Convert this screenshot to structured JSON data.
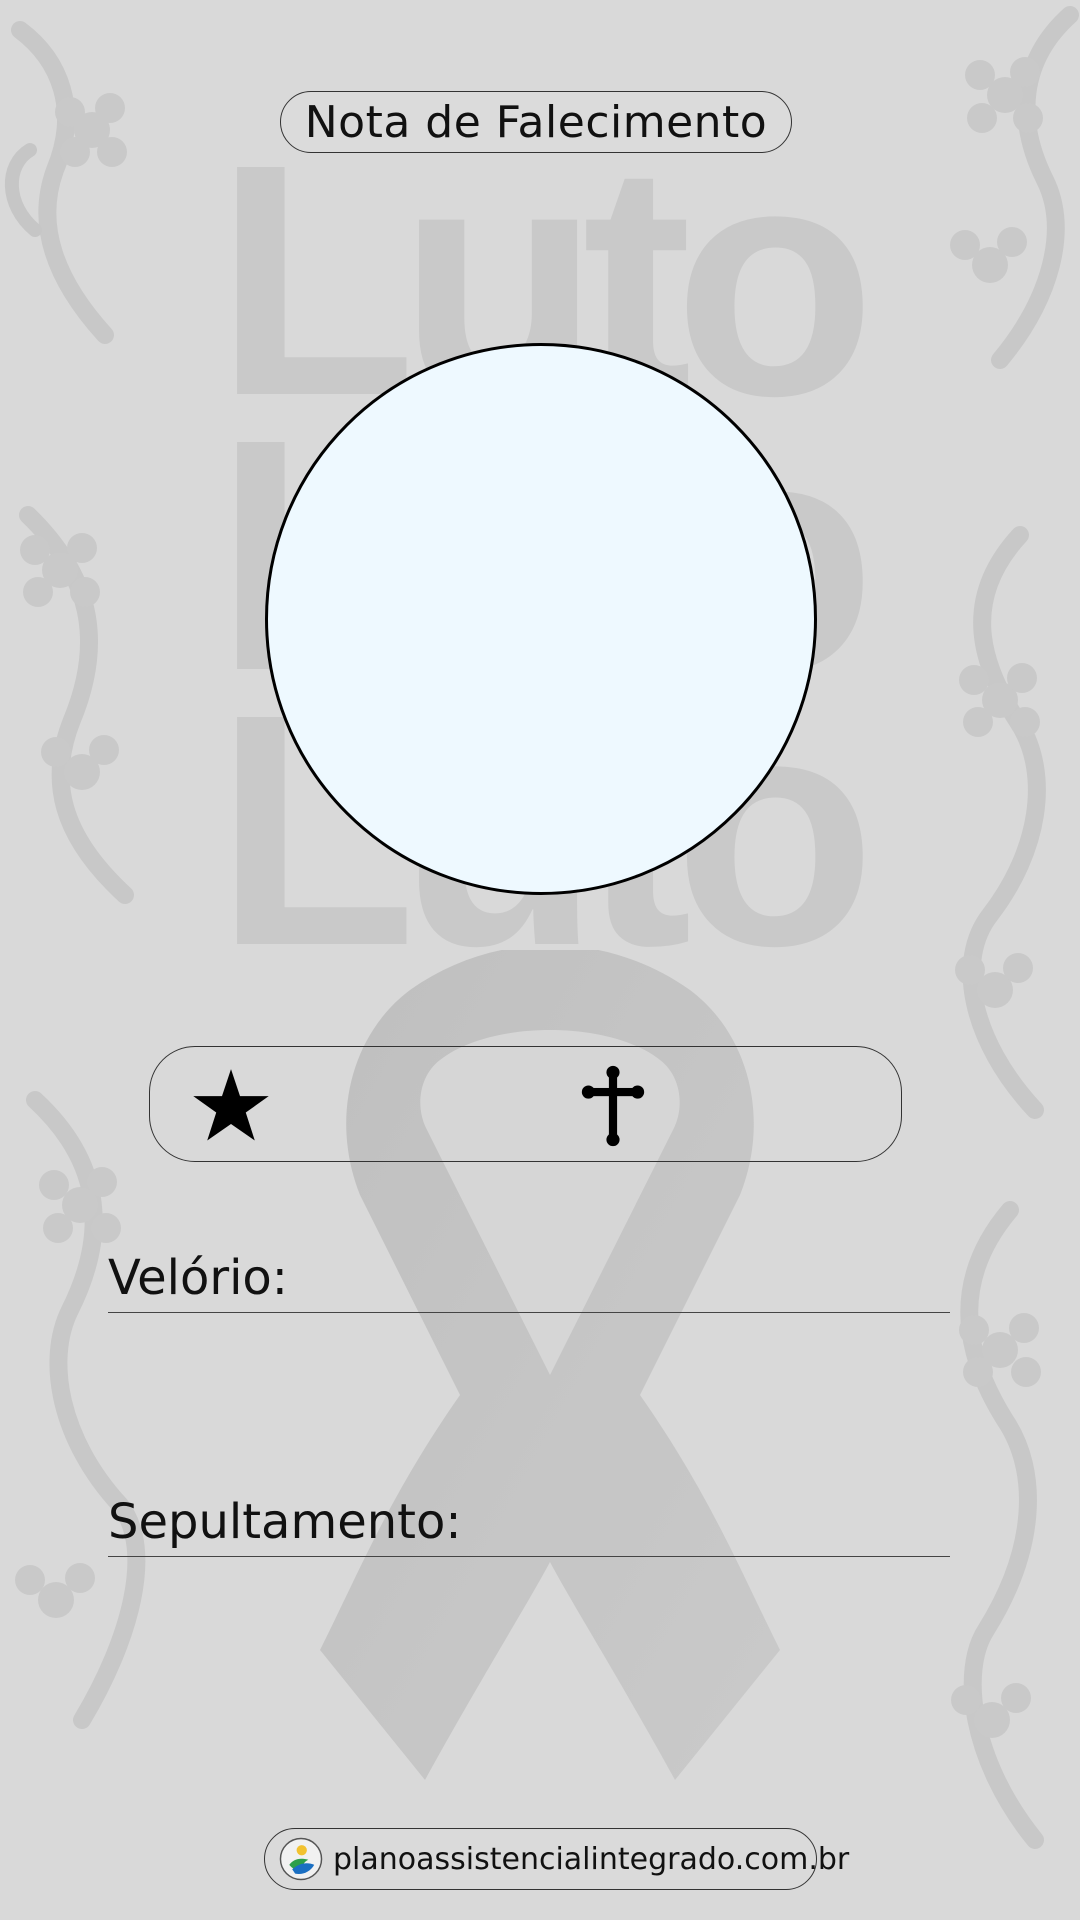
{
  "card": {
    "title": "Nota de Falecimento",
    "watermark_word": "Luto"
  },
  "photo": {
    "fill_color": "#eef9ff",
    "border_color": "#000000"
  },
  "dates": {
    "birth_icon": "star-icon",
    "death_icon": "cross-icon"
  },
  "fields": {
    "wake_label": "Velório:",
    "burial_label": "Sepultamento:"
  },
  "footer": {
    "website": "planoassistencialintegrado.com.br",
    "logo_icon": "brand-logo-icon"
  },
  "colors": {
    "background": "#d9d9d9",
    "pattern": "#c4c4c4",
    "text": "#111111"
  }
}
